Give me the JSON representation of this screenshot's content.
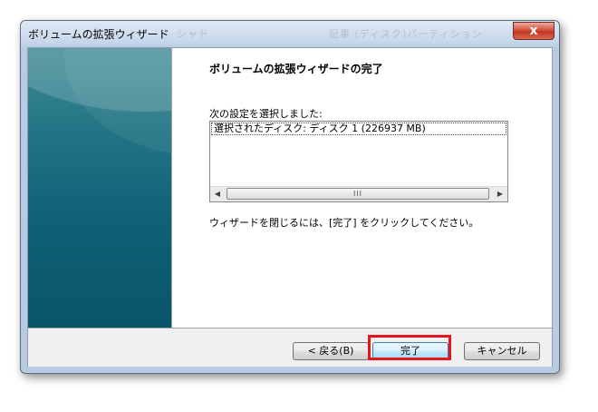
{
  "window": {
    "title": "ボリュームの拡張ウィザード",
    "faint_title_left": "シャド",
    "faint_title_right": "記事 (ディスク)パーティション",
    "close_label": "x"
  },
  "content": {
    "heading": "ボリュームの拡張ウィザードの完了",
    "settings_label": "次の設定を選択しました:",
    "settings_items": [
      "選択されたディスク: ディスク 1 (226937 MB)"
    ],
    "instruction": "ウィザードを閉じるには、[完了] をクリックしてください。"
  },
  "scrollbar": {
    "left_arrow": "◀",
    "right_arrow": "▶",
    "thumb_grip": "III"
  },
  "buttons": {
    "back": "< 戻る(B)",
    "finish": "完了",
    "cancel": "キャンセル"
  },
  "colors": {
    "highlight": "#e8141c",
    "sidebar": "#0f6277"
  }
}
